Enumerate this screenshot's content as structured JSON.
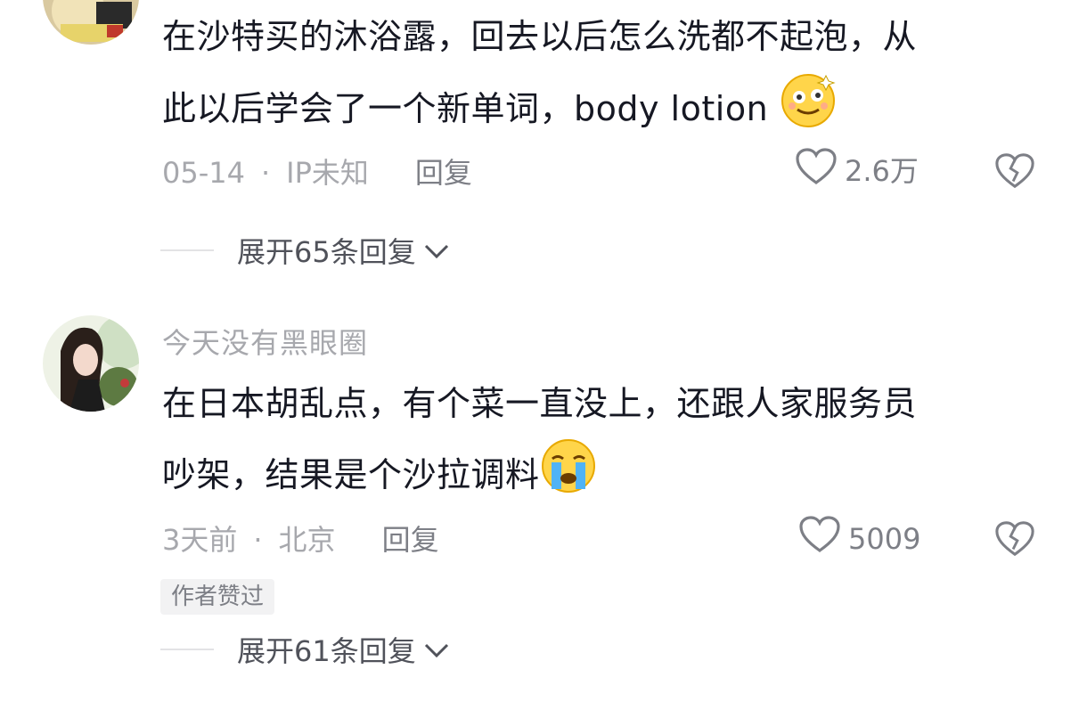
{
  "comments": [
    {
      "content_line1": "在沙特买的沐浴露，回去以后怎么洗都不起泡，从",
      "content_line2": "此以后学会了一个新单词，body lotion",
      "emoji": "dizzy-face",
      "date": "05-14",
      "location": "IP未知",
      "reply_label": "回复",
      "likes": "2.6万",
      "expand_label": "展开65条回复"
    },
    {
      "username": "今天没有黑眼圈",
      "content_line1": "在日本胡乱点，有个菜一直没上，还跟人家服务员",
      "content_line2": "吵架，结果是个沙拉调料",
      "emoji": "loudly-crying-face",
      "date": "3天前",
      "location": "北京",
      "reply_label": "回复",
      "likes": "5009",
      "badge": "作者赞过",
      "expand_label": "展开61条回复"
    }
  ],
  "separator": "·",
  "colors": {
    "text_primary": "#161823",
    "text_secondary": "#a7a8ad",
    "action": "#7d7f86"
  }
}
